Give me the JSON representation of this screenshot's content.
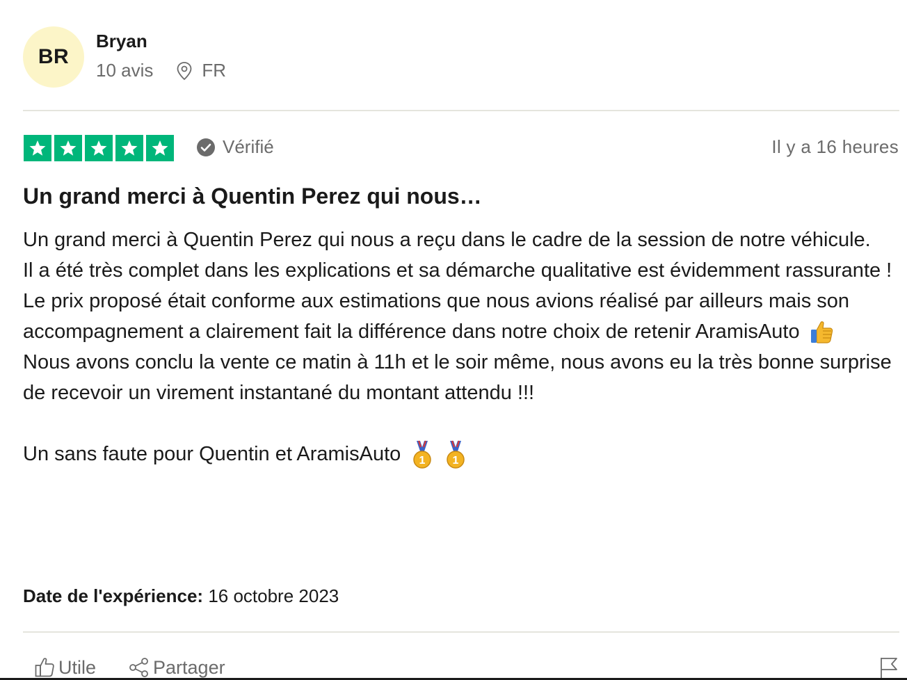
{
  "reviewer": {
    "initials": "BR",
    "name": "Bryan",
    "review_count": "10 avis",
    "country": "FR",
    "avatar_color": "#fcf5c8"
  },
  "rating": {
    "stars": 5,
    "max_stars": 5,
    "star_color": "#00b67a",
    "verified_label": "Vérifié",
    "posted_ago": "Il y a 16 heures"
  },
  "review": {
    "title": "Un grand merci à Quentin Perez qui nous…",
    "body": {
      "p1": "Un grand merci à Quentin Perez qui nous a reçu dans le cadre de la session de notre véhicule.",
      "p2": "Il a été très complet dans les explications et sa démarche qualitative est évidemment rassurante !",
      "p3": "Le prix proposé était conforme aux estimations que nous avions réalisé par ailleurs mais son accompagnement a clairement fait la différence dans notre choix de retenir AramisAuto",
      "p4": "Nous avons conclu la vente ce matin à 11h et le soir même, nous avons eu la très bonne surprise de recevoir un virement instantané du montant attendu !!!",
      "p5": "Un sans faute pour Quentin et AramisAuto"
    },
    "emojis": {
      "p3_end": "thumbs-up-icon",
      "p5_end": [
        "medal-icon",
        "medal-icon"
      ]
    },
    "experience_label": "Date de l'expérience:",
    "experience_date": "16 octobre 2023"
  },
  "actions": {
    "useful_label": "Utile",
    "share_label": "Partager",
    "report_icon": "flag-icon"
  }
}
